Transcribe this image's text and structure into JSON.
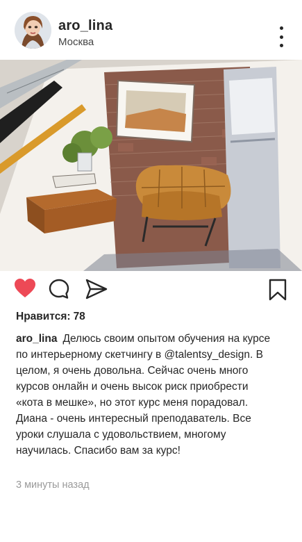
{
  "post": {
    "username": "aro_lina",
    "location": "Москва",
    "likes_label": "Нравится:",
    "likes_count": "78",
    "caption_author": "aro_lina",
    "caption_text": "Делюсь своим опытом обучения на курсе по интерьерному скетчингу в @talentsy_design. В целом, я очень довольна. Сейчас очень много курсов онлайн и очень высок риск приобрести «кота в мешке», но этот курс меня порадовал. Диана - очень интересный преподаватель. Все уроки слушала с удовольствием, многому научилась. Спасибо вам за курс!",
    "timestamp": "3 минуты назад",
    "liked": true
  },
  "icons": {
    "like": "heart-icon",
    "comment": "comment-icon",
    "share": "share-icon",
    "save": "bookmark-icon",
    "more": "more-vertical-icon"
  },
  "colors": {
    "like_active": "#ed4956",
    "text": "#262626",
    "muted": "#9a9a9a"
  }
}
